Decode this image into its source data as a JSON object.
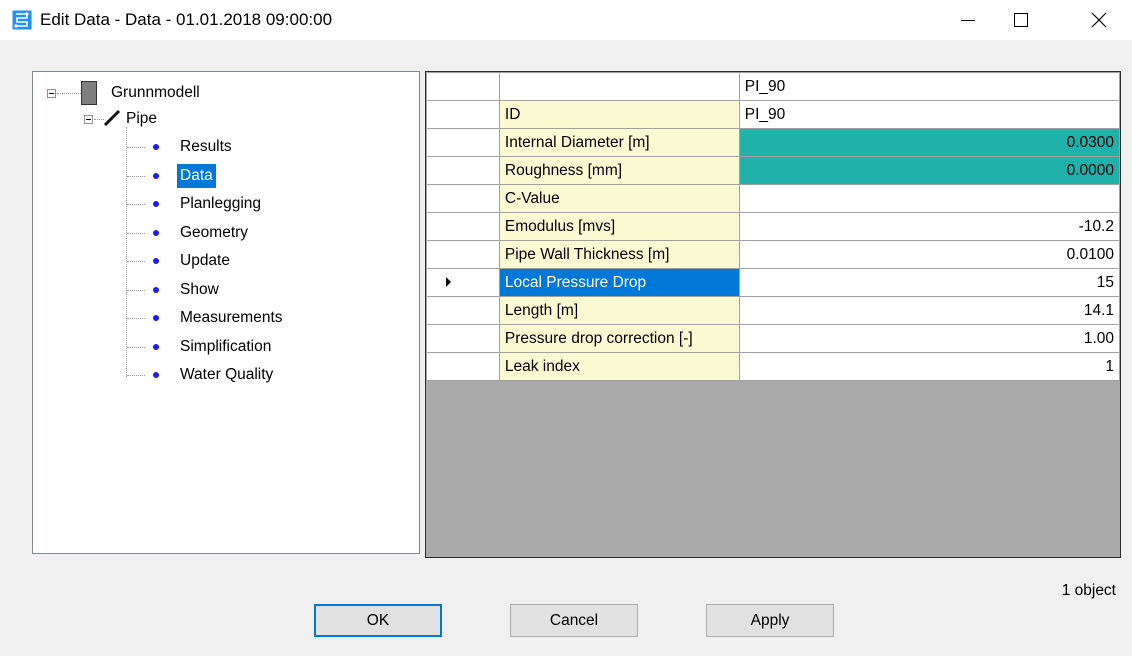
{
  "window": {
    "title": "Edit Data - Data - 01.01.2018 09:00:00",
    "icon": "app-icon",
    "accent_color": "#0078d7"
  },
  "tree": {
    "root": {
      "label": "Grunnmodell",
      "icon": "model-block-icon"
    },
    "child": {
      "label": "Pipe",
      "icon": "pipe-pen-icon"
    },
    "items": [
      {
        "label": "Results",
        "selected": false
      },
      {
        "label": "Data",
        "selected": true
      },
      {
        "label": "Planlegging",
        "selected": false
      },
      {
        "label": "Geometry",
        "selected": false
      },
      {
        "label": "Update",
        "selected": false
      },
      {
        "label": "Show",
        "selected": false
      },
      {
        "label": "Measurements",
        "selected": false
      },
      {
        "label": "Simplification",
        "selected": false
      },
      {
        "label": "Water Quality",
        "selected": false
      }
    ]
  },
  "grid": {
    "column_header": "PI_90",
    "rows": [
      {
        "name": "ID",
        "value": "PI_90",
        "align": "left",
        "highlight": false,
        "selected": false
      },
      {
        "name": "Internal Diameter [m]",
        "value": "0.0300",
        "highlight": true,
        "selected": false
      },
      {
        "name": "Roughness [mm]",
        "value": "0.0000",
        "highlight": true,
        "selected": false
      },
      {
        "name": "C-Value",
        "value": "",
        "highlight": false,
        "selected": false
      },
      {
        "name": "Emodulus [mvs]",
        "value": "-10.2",
        "highlight": false,
        "selected": false
      },
      {
        "name": "Pipe Wall Thickness [m]",
        "value": "0.0100",
        "highlight": false,
        "selected": false
      },
      {
        "name": "Local Pressure Drop",
        "value": "15",
        "highlight": false,
        "selected": true
      },
      {
        "name": "Length [m]",
        "value": "14.1",
        "highlight": false,
        "selected": false
      },
      {
        "name": "Pressure drop correction [-]",
        "value": "1.00",
        "highlight": false,
        "selected": false
      },
      {
        "name": "Leak index",
        "value": "1",
        "highlight": false,
        "selected": false
      }
    ],
    "highlight_color": "#20b2aa"
  },
  "footer": {
    "count": "1 object",
    "ok": "OK",
    "cancel": "Cancel",
    "apply": "Apply"
  }
}
